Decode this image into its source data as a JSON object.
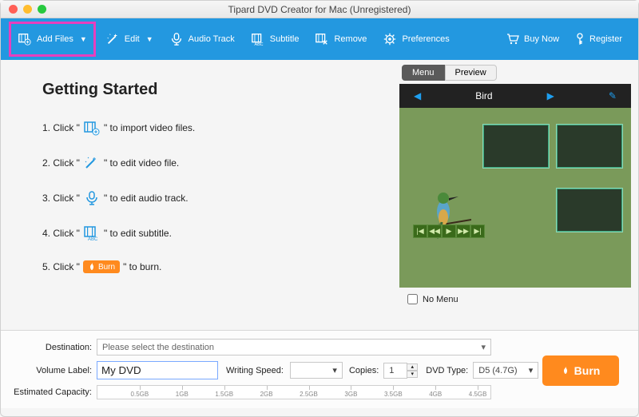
{
  "window": {
    "title": "Tipard DVD Creator for Mac (Unregistered)"
  },
  "toolbar": {
    "addFiles": "Add Files",
    "edit": "Edit",
    "audio": "Audio Track",
    "subtitle": "Subtitle",
    "remove": "Remove",
    "preferences": "Preferences",
    "buyNow": "Buy Now",
    "register": "Register"
  },
  "getting": {
    "title": "Getting Started",
    "s1a": "1. Click \" ",
    "s1b": " \" to import video files.",
    "s2a": "2. Click \" ",
    "s2b": " \" to edit video file.",
    "s3a": "3. Click \" ",
    "s3b": " \" to edit audio track.",
    "s4a": "4. Click \" ",
    "s4b": " \" to edit subtitle.",
    "s5a": "5. Click \" ",
    "s5b": " \" to burn.",
    "burn": "Burn"
  },
  "preview": {
    "tabs": {
      "menu": "Menu",
      "preview": "Preview"
    },
    "title": "Bird",
    "noMenu": "No Menu"
  },
  "bottom": {
    "destinationLabel": "Destination:",
    "destinationValue": "Please select the destination",
    "volumeLabel": "Volume Label:",
    "volumeValue": "My DVD",
    "writingSpeedLabel": "Writing Speed:",
    "copiesLabel": "Copies:",
    "copiesValue": "1",
    "dvdTypeLabel": "DVD Type:",
    "dvdTypeValue": "D5 (4.7G)",
    "capacityLabel": "Estimated Capacity:",
    "ticks": [
      "0.5GB",
      "1GB",
      "1.5GB",
      "2GB",
      "2.5GB",
      "3GB",
      "3.5GB",
      "4GB",
      "4.5GB"
    ],
    "burn": "Burn"
  }
}
